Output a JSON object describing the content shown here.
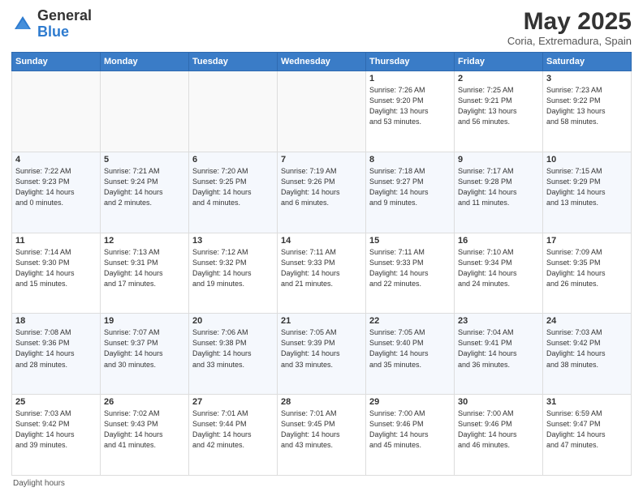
{
  "header": {
    "logo_general": "General",
    "logo_blue": "Blue",
    "month": "May 2025",
    "location": "Coria, Extremadura, Spain"
  },
  "weekdays": [
    "Sunday",
    "Monday",
    "Tuesday",
    "Wednesday",
    "Thursday",
    "Friday",
    "Saturday"
  ],
  "footer": "Daylight hours",
  "weeks": [
    [
      {
        "day": "",
        "info": ""
      },
      {
        "day": "",
        "info": ""
      },
      {
        "day": "",
        "info": ""
      },
      {
        "day": "",
        "info": ""
      },
      {
        "day": "1",
        "info": "Sunrise: 7:26 AM\nSunset: 9:20 PM\nDaylight: 13 hours\nand 53 minutes."
      },
      {
        "day": "2",
        "info": "Sunrise: 7:25 AM\nSunset: 9:21 PM\nDaylight: 13 hours\nand 56 minutes."
      },
      {
        "day": "3",
        "info": "Sunrise: 7:23 AM\nSunset: 9:22 PM\nDaylight: 13 hours\nand 58 minutes."
      }
    ],
    [
      {
        "day": "4",
        "info": "Sunrise: 7:22 AM\nSunset: 9:23 PM\nDaylight: 14 hours\nand 0 minutes."
      },
      {
        "day": "5",
        "info": "Sunrise: 7:21 AM\nSunset: 9:24 PM\nDaylight: 14 hours\nand 2 minutes."
      },
      {
        "day": "6",
        "info": "Sunrise: 7:20 AM\nSunset: 9:25 PM\nDaylight: 14 hours\nand 4 minutes."
      },
      {
        "day": "7",
        "info": "Sunrise: 7:19 AM\nSunset: 9:26 PM\nDaylight: 14 hours\nand 6 minutes."
      },
      {
        "day": "8",
        "info": "Sunrise: 7:18 AM\nSunset: 9:27 PM\nDaylight: 14 hours\nand 9 minutes."
      },
      {
        "day": "9",
        "info": "Sunrise: 7:17 AM\nSunset: 9:28 PM\nDaylight: 14 hours\nand 11 minutes."
      },
      {
        "day": "10",
        "info": "Sunrise: 7:15 AM\nSunset: 9:29 PM\nDaylight: 14 hours\nand 13 minutes."
      }
    ],
    [
      {
        "day": "11",
        "info": "Sunrise: 7:14 AM\nSunset: 9:30 PM\nDaylight: 14 hours\nand 15 minutes."
      },
      {
        "day": "12",
        "info": "Sunrise: 7:13 AM\nSunset: 9:31 PM\nDaylight: 14 hours\nand 17 minutes."
      },
      {
        "day": "13",
        "info": "Sunrise: 7:12 AM\nSunset: 9:32 PM\nDaylight: 14 hours\nand 19 minutes."
      },
      {
        "day": "14",
        "info": "Sunrise: 7:11 AM\nSunset: 9:33 PM\nDaylight: 14 hours\nand 21 minutes."
      },
      {
        "day": "15",
        "info": "Sunrise: 7:11 AM\nSunset: 9:33 PM\nDaylight: 14 hours\nand 22 minutes."
      },
      {
        "day": "16",
        "info": "Sunrise: 7:10 AM\nSunset: 9:34 PM\nDaylight: 14 hours\nand 24 minutes."
      },
      {
        "day": "17",
        "info": "Sunrise: 7:09 AM\nSunset: 9:35 PM\nDaylight: 14 hours\nand 26 minutes."
      }
    ],
    [
      {
        "day": "18",
        "info": "Sunrise: 7:08 AM\nSunset: 9:36 PM\nDaylight: 14 hours\nand 28 minutes."
      },
      {
        "day": "19",
        "info": "Sunrise: 7:07 AM\nSunset: 9:37 PM\nDaylight: 14 hours\nand 30 minutes."
      },
      {
        "day": "20",
        "info": "Sunrise: 7:06 AM\nSunset: 9:38 PM\nDaylight: 14 hours\nand 33 minutes."
      },
      {
        "day": "21",
        "info": "Sunrise: 7:05 AM\nSunset: 9:39 PM\nDaylight: 14 hours\nand 33 minutes."
      },
      {
        "day": "22",
        "info": "Sunrise: 7:05 AM\nSunset: 9:40 PM\nDaylight: 14 hours\nand 35 minutes."
      },
      {
        "day": "23",
        "info": "Sunrise: 7:04 AM\nSunset: 9:41 PM\nDaylight: 14 hours\nand 36 minutes."
      },
      {
        "day": "24",
        "info": "Sunrise: 7:03 AM\nSunset: 9:42 PM\nDaylight: 14 hours\nand 38 minutes."
      }
    ],
    [
      {
        "day": "25",
        "info": "Sunrise: 7:03 AM\nSunset: 9:42 PM\nDaylight: 14 hours\nand 39 minutes."
      },
      {
        "day": "26",
        "info": "Sunrise: 7:02 AM\nSunset: 9:43 PM\nDaylight: 14 hours\nand 41 minutes."
      },
      {
        "day": "27",
        "info": "Sunrise: 7:01 AM\nSunset: 9:44 PM\nDaylight: 14 hours\nand 42 minutes."
      },
      {
        "day": "28",
        "info": "Sunrise: 7:01 AM\nSunset: 9:45 PM\nDaylight: 14 hours\nand 43 minutes."
      },
      {
        "day": "29",
        "info": "Sunrise: 7:00 AM\nSunset: 9:46 PM\nDaylight: 14 hours\nand 45 minutes."
      },
      {
        "day": "30",
        "info": "Sunrise: 7:00 AM\nSunset: 9:46 PM\nDaylight: 14 hours\nand 46 minutes."
      },
      {
        "day": "31",
        "info": "Sunrise: 6:59 AM\nSunset: 9:47 PM\nDaylight: 14 hours\nand 47 minutes."
      }
    ]
  ]
}
